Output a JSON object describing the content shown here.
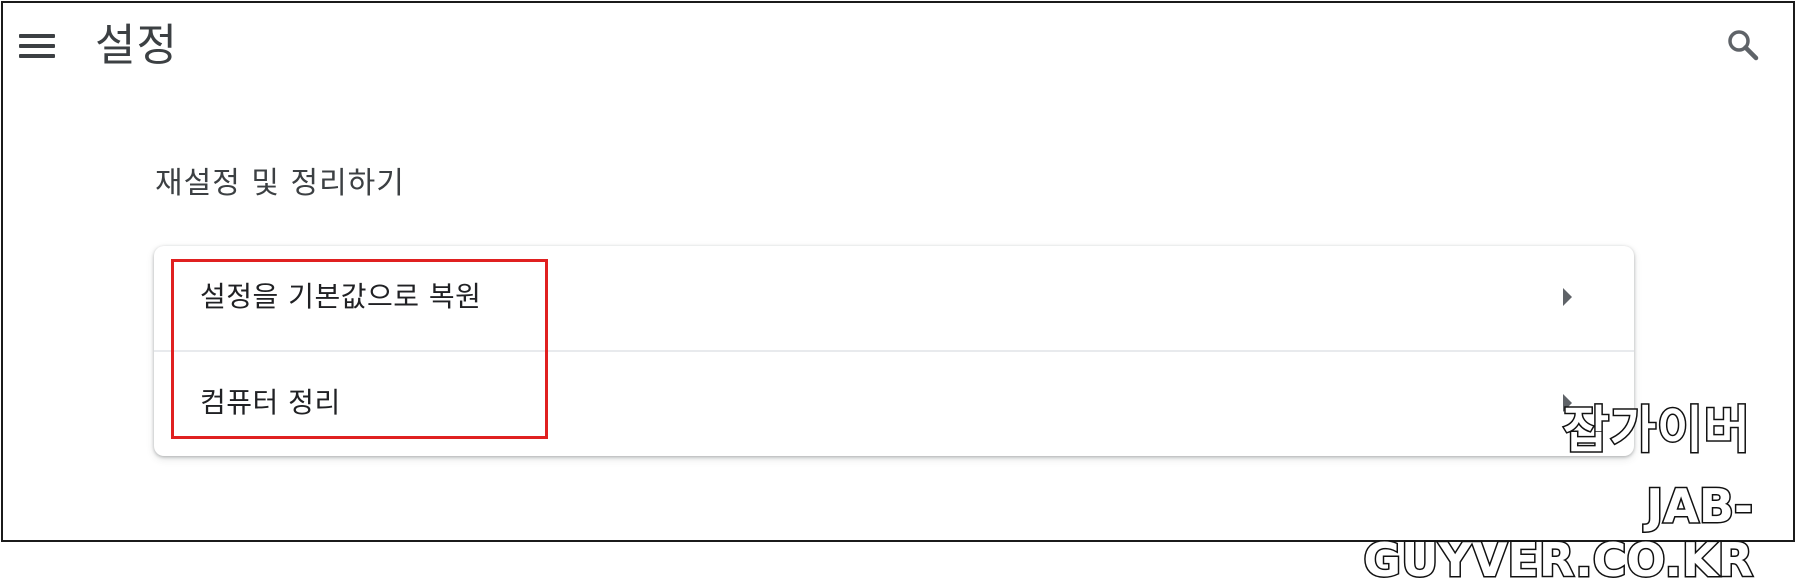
{
  "header": {
    "menu_icon": "hamburger-menu-icon",
    "title": "설정",
    "search_icon": "search-icon"
  },
  "section": {
    "title": "재설정 및 정리하기",
    "items": [
      {
        "label": "설정을 기본값으로 복원",
        "icon": "chevron-right-icon"
      },
      {
        "label": "컴퓨터 정리",
        "icon": "chevron-right-icon"
      }
    ]
  },
  "annotation": {
    "highlight_color": "#e02020"
  },
  "watermark": {
    "korean": "잡가이버",
    "english": "JAB-GUYVER.CO.KR"
  },
  "colors": {
    "background": "#ffffff",
    "text_primary": "#202124",
    "text_secondary": "#3c4043",
    "icon": "#5f6368",
    "divider": "#e8eaed"
  }
}
